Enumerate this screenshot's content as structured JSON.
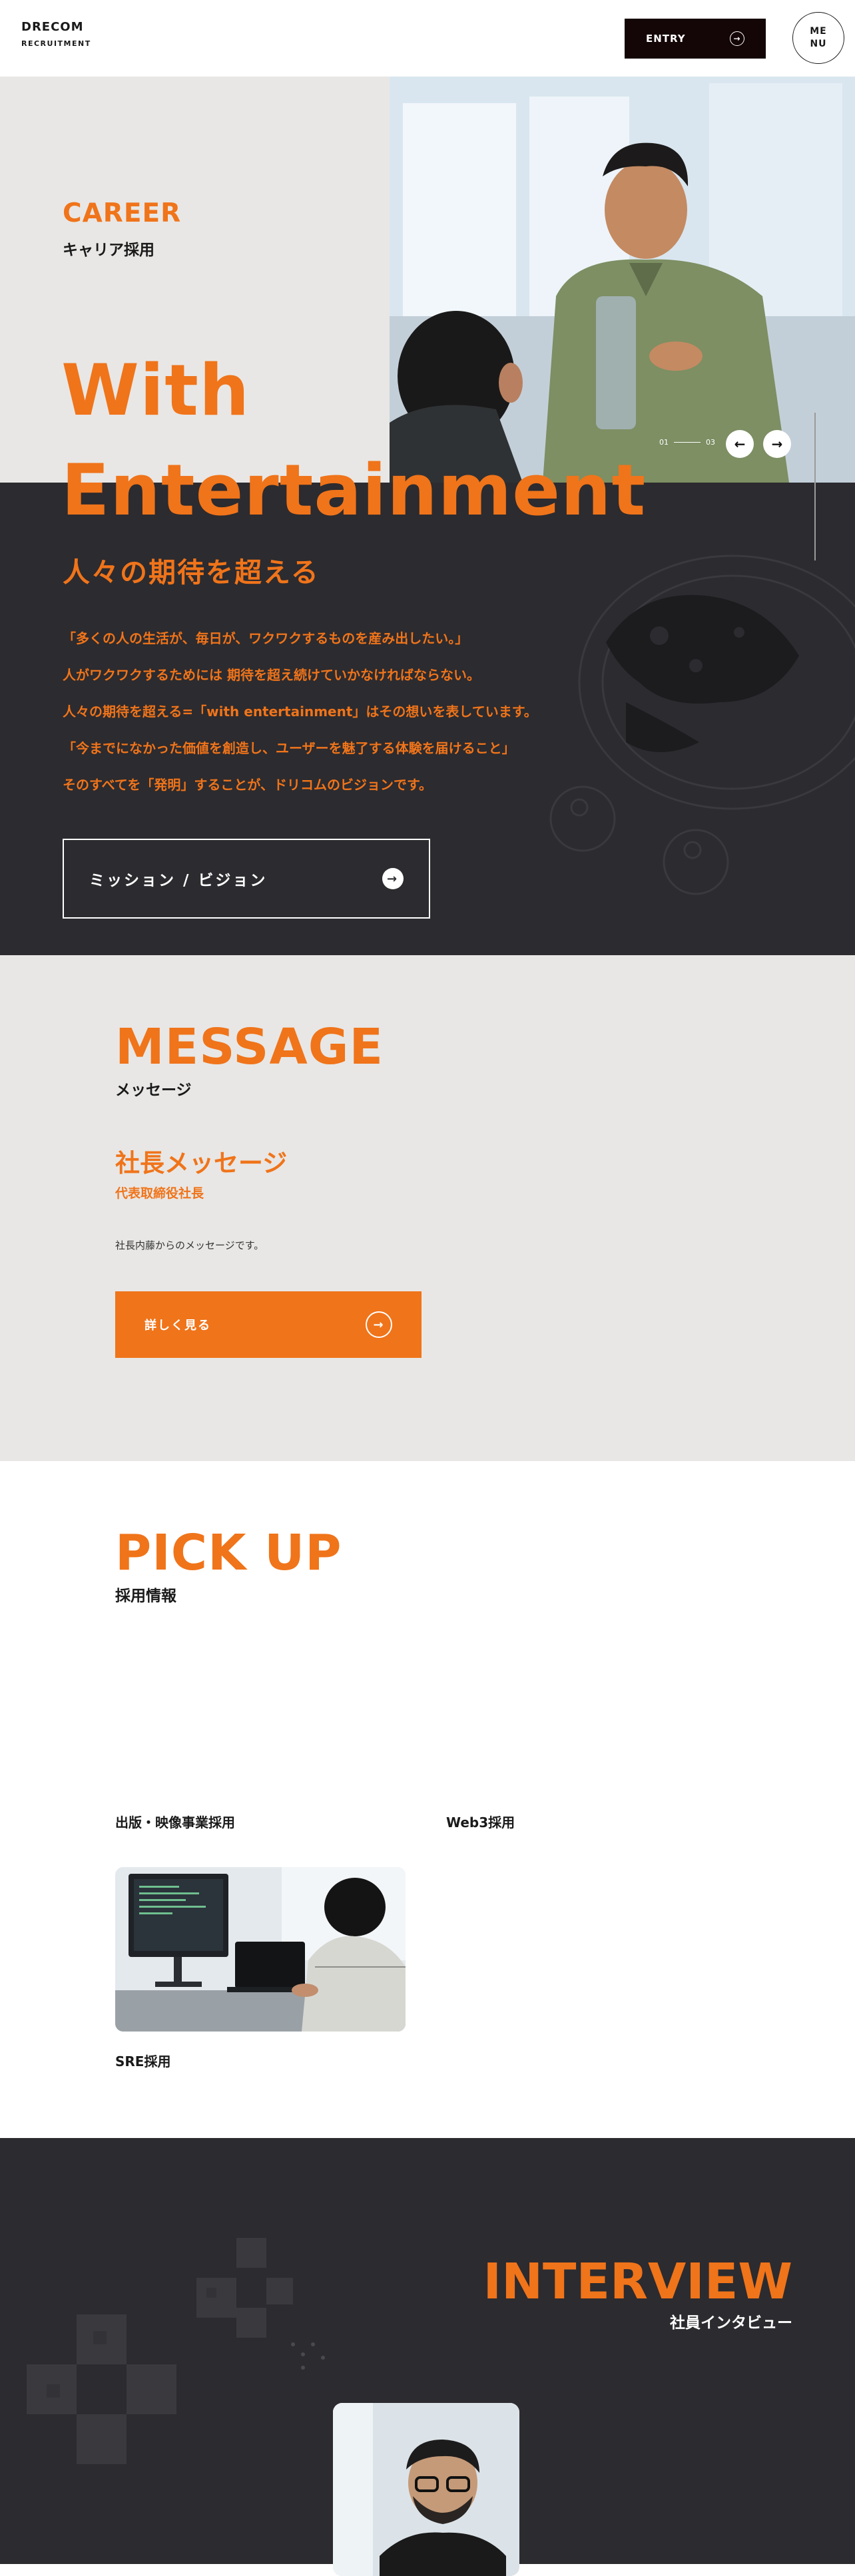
{
  "header": {
    "logo_main": "DRECOM",
    "logo_sub": "RECRUITMENT",
    "entry_label": "ENTRY",
    "menu_line1": "ME",
    "menu_line2": "NU"
  },
  "hero": {
    "career": "CAREER",
    "career_sub": "キャリア採用",
    "headline_line1": "With",
    "headline_line2": "Entertainment",
    "slider_current": "01",
    "slider_total": "03",
    "tagline": "人々の期待を超える",
    "body_lines": [
      "「多くの人の生活が、毎日が、ワクワクするものを産み出したい。」",
      "人がワクワクするためには 期待を超え続けていかなければならない。",
      "人々の期待を超える=「with entertainment」はその想いを表しています。",
      "「今までになかった価値を創造し、ユーザーを魅了する体験を届けること」",
      "そのすべてを「発明」することが、ドリコムのビジョンです。"
    ],
    "mission_button": "ミッション / ビジョン"
  },
  "message": {
    "title": "MESSAGE",
    "subtitle": "メッセージ",
    "heading": "社長メッセージ",
    "role": "代表取締役社長",
    "text": "社長内藤からのメッセージです。",
    "button": "詳しく見る"
  },
  "pickup": {
    "title": "PICK UP",
    "subtitle": "採用情報",
    "items": [
      {
        "label": "出版・映像事業採用"
      },
      {
        "label": "Web3採用"
      },
      {
        "label": "SRE採用"
      }
    ]
  },
  "interview": {
    "title": "INTERVIEW",
    "subtitle": "社員インタビュー"
  },
  "colors": {
    "accent": "#f0741a",
    "dark": "#2c2b2f",
    "light_gray": "#e8e7e5",
    "entry_bg": "#140506"
  },
  "icons": [
    "arrow-right-circle-icon",
    "arrow-left-icon",
    "arrow-right-icon"
  ]
}
